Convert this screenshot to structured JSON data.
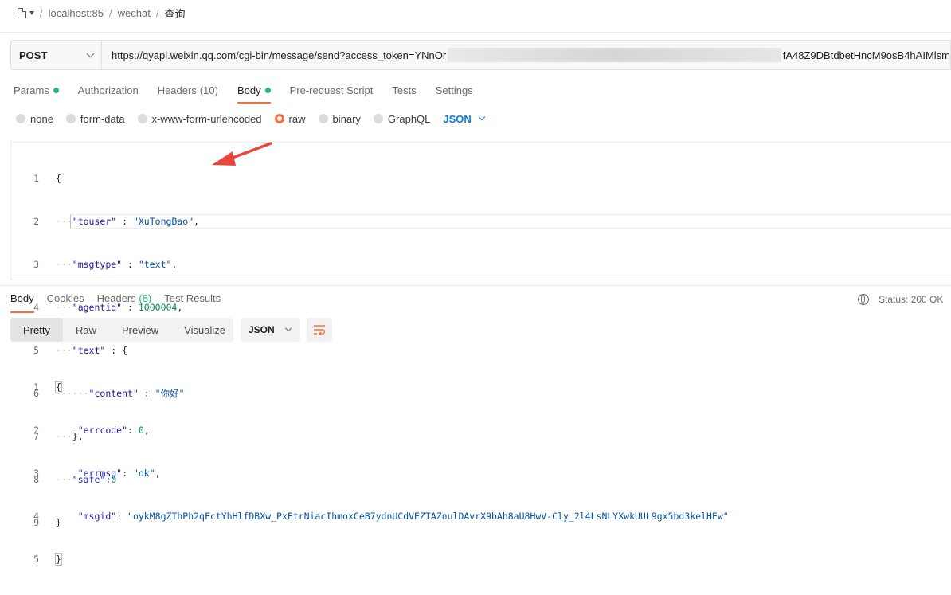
{
  "breadcrumb": {
    "parts": [
      "localhost:85",
      "wechat",
      "查询"
    ]
  },
  "request": {
    "method": "POST",
    "url_start": "https://qyapi.weixin.qq.com/cgi-bin/message/send?access_token=YNnOr",
    "url_end": "fA48Z9DBtdbetHncM9osB4hAIMlsm"
  },
  "request_tabs": [
    {
      "label": "Params"
    },
    {
      "label": "Authorization"
    },
    {
      "label": "Headers",
      "count": "(10)"
    },
    {
      "label": "Body"
    },
    {
      "label": "Pre-request Script"
    },
    {
      "label": "Tests"
    },
    {
      "label": "Settings"
    }
  ],
  "body_types": [
    "none",
    "form-data",
    "x-www-form-urlencoded",
    "raw",
    "binary",
    "GraphQL"
  ],
  "body_format": "JSON",
  "request_body": {
    "line_numbers": [
      "1",
      "2",
      "3",
      "4",
      "5",
      "6",
      "7",
      "8",
      "9"
    ],
    "k_touser": "\"touser\"",
    "v_touser": "\"XuTongBao\"",
    "k_msgtype": "\"msgtype\"",
    "v_msgtype": "\"text\"",
    "k_agentid": "\"agentid\"",
    "v_agentid": "1000004",
    "k_text": "\"text\"",
    "k_content": "\"content\"",
    "v_content": "\"你好\"",
    "k_safe": "\"safe\"",
    "v_safe": "0"
  },
  "response_tabs": {
    "body": "Body",
    "cookies": "Cookies",
    "headers": "Headers",
    "headers_count": "(8)",
    "test_results": "Test Results"
  },
  "status_text": "Status: 200 OK",
  "view_modes": [
    "Pretty",
    "Raw",
    "Preview",
    "Visualize"
  ],
  "response_format": "JSON",
  "response_body": {
    "line_numbers": [
      "1",
      "2",
      "3",
      "4",
      "5"
    ],
    "k_errcode": "\"errcode\"",
    "v_errcode": "0",
    "k_errmsg": "\"errmsg\"",
    "v_errmsg": "\"ok\"",
    "k_msgid": "\"msgid\"",
    "v_msgid": "\"oykM8gZThPh2qFctYhHlfDBXw_PxEtrNiacIhmoxCeB7ydnUCdVEZTAZnulDAvrX9bAh8aU8HwV-Cly_2l4LsNLYXwkUUL9gx5bd3kelHFw\""
  },
  "colors": {
    "accent": "#ff6c37",
    "active_dot": "#26b47f",
    "link": "#097bed",
    "annotation_arrow": "#e8473b"
  }
}
